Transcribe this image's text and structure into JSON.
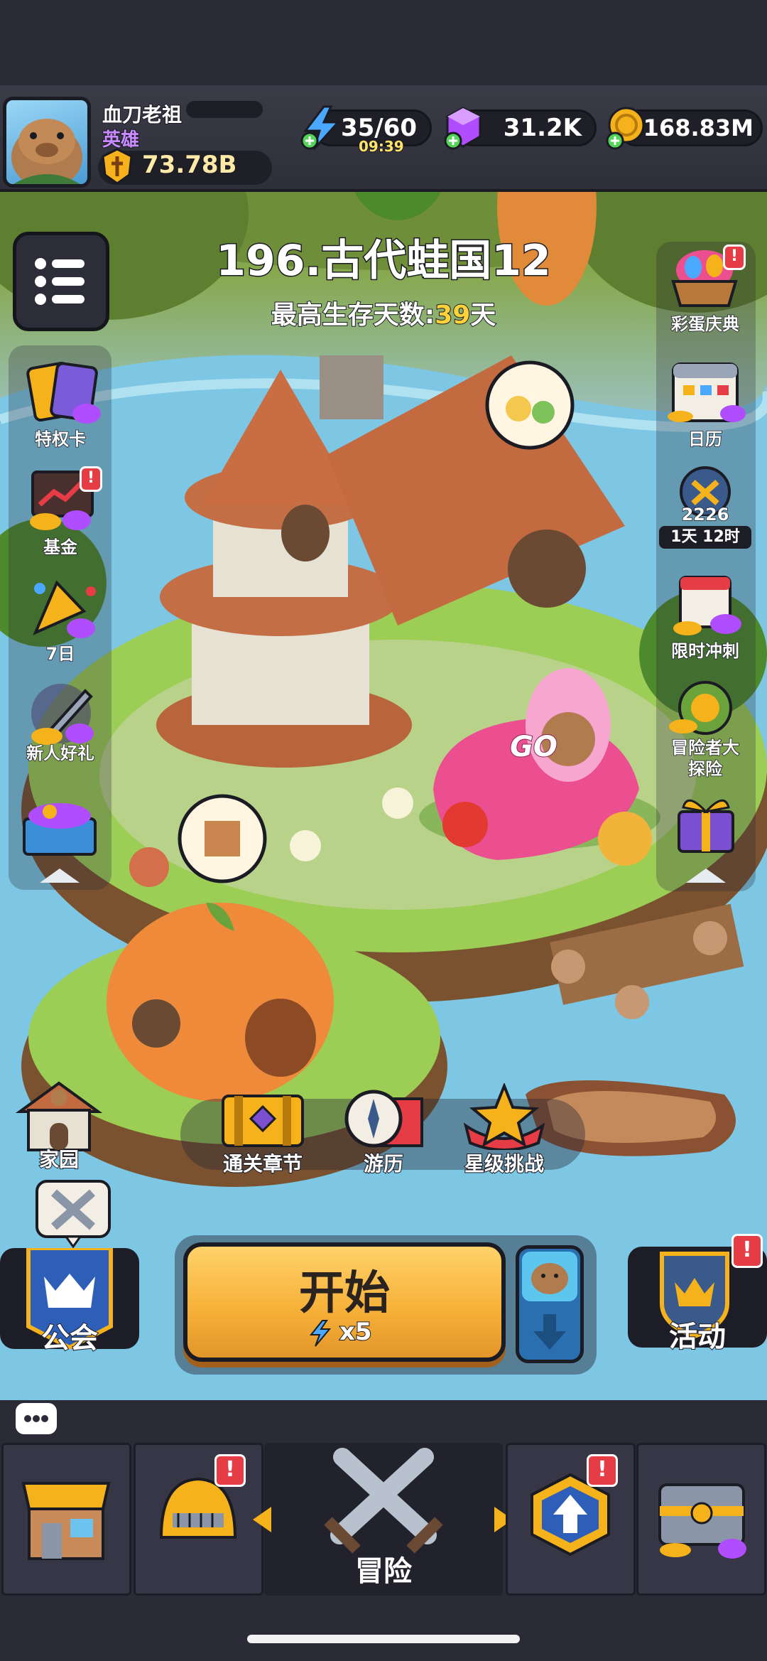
{
  "player": {
    "name": "血刀老祖",
    "rank": "英雄",
    "power": "73.78B"
  },
  "resources": {
    "energy": "35/60",
    "energy_timer": "09:39",
    "gems": "31.2K",
    "coins": "168.83M"
  },
  "stage": {
    "title": "196.古代蛙国12",
    "record_label": "最高生存天数:",
    "record_value": "39",
    "record_unit": "天"
  },
  "left_menu": {
    "privilege_card": "特权卡",
    "fund": "基金",
    "seven_day": "7日",
    "newbie_gift": "新人好礼"
  },
  "right_menu": {
    "easter_egg": "彩蛋庆典",
    "calendar": "日历",
    "arena_score": "2226",
    "arena_timer": "1天 12时",
    "limited_sprint": "限时冲刺",
    "explorer_line1": "冒险者大",
    "explorer_line2": "探险"
  },
  "kart_text": "GO",
  "features": {
    "home": "家园",
    "chapter_clear": "通关章节",
    "travel": "游历",
    "star_challenge": "星级挑战"
  },
  "actions": {
    "guild": "公会",
    "start": "开始",
    "start_cost": "x5",
    "events": "活动"
  },
  "badges": {
    "alert": "!"
  },
  "bottom_nav": {
    "adventure": "冒险"
  },
  "colors": {
    "energy": "#4aa8ff",
    "gem": "#b04dff",
    "coin": "#f5b21b",
    "start_button": "#f7b23a",
    "badge_red": "#e53c45",
    "record_highlight": "#ffd23a",
    "rank_purple": "#c78bff"
  },
  "icons": [
    "menu-icon",
    "energy-icon",
    "gem-icon",
    "coin-icon",
    "power-icon",
    "chat-icon",
    "shop-icon",
    "helmet-icon",
    "crossed-swords-icon",
    "upgrade-icon",
    "chest-icon"
  ]
}
